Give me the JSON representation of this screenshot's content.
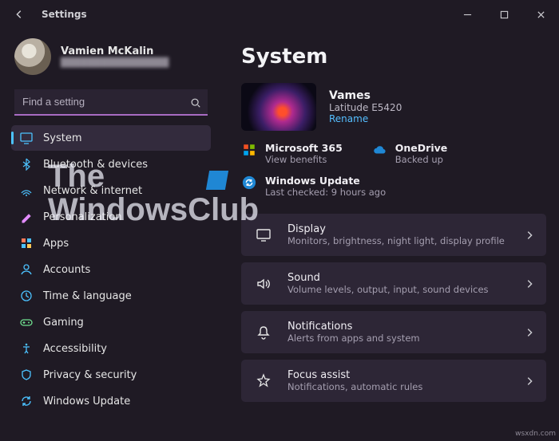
{
  "window": {
    "title": "Settings"
  },
  "profile": {
    "name": "Vamien McKalin",
    "email": "████████████████"
  },
  "search": {
    "placeholder": "Find a setting"
  },
  "sidebar": [
    {
      "icon": "system",
      "label": "System",
      "selected": true
    },
    {
      "icon": "bluetooth",
      "label": "Bluetooth & devices",
      "selected": false
    },
    {
      "icon": "network",
      "label": "Network & internet",
      "selected": false
    },
    {
      "icon": "personalization",
      "label": "Personalization",
      "selected": false
    },
    {
      "icon": "apps",
      "label": "Apps",
      "selected": false
    },
    {
      "icon": "accounts",
      "label": "Accounts",
      "selected": false
    },
    {
      "icon": "time",
      "label": "Time & language",
      "selected": false
    },
    {
      "icon": "gaming",
      "label": "Gaming",
      "selected": false
    },
    {
      "icon": "accessibility",
      "label": "Accessibility",
      "selected": false
    },
    {
      "icon": "privacy",
      "label": "Privacy & security",
      "selected": false
    },
    {
      "icon": "update",
      "label": "Windows Update",
      "selected": false
    }
  ],
  "content": {
    "heading": "System",
    "device": {
      "name": "Vames",
      "model": "Latitude E5420",
      "rename": "Rename"
    },
    "status": [
      {
        "icon": "ms365",
        "title": "Microsoft 365",
        "sub": "View benefits"
      },
      {
        "icon": "onedrive",
        "title": "OneDrive",
        "sub": "Backed up"
      },
      {
        "icon": "update",
        "title": "Windows Update",
        "sub": "Last checked: 9 hours ago"
      }
    ],
    "cards": [
      {
        "icon": "display",
        "title": "Display",
        "sub": "Monitors, brightness, night light, display profile"
      },
      {
        "icon": "sound",
        "title": "Sound",
        "sub": "Volume levels, output, input, sound devices"
      },
      {
        "icon": "notifications",
        "title": "Notifications",
        "sub": "Alerts from apps and system"
      },
      {
        "icon": "focus",
        "title": "Focus assist",
        "sub": "Notifications, automatic rules"
      }
    ]
  },
  "watermark": {
    "line1": "The",
    "line2": "WindowsClub"
  },
  "footer": "wsxdn.com"
}
